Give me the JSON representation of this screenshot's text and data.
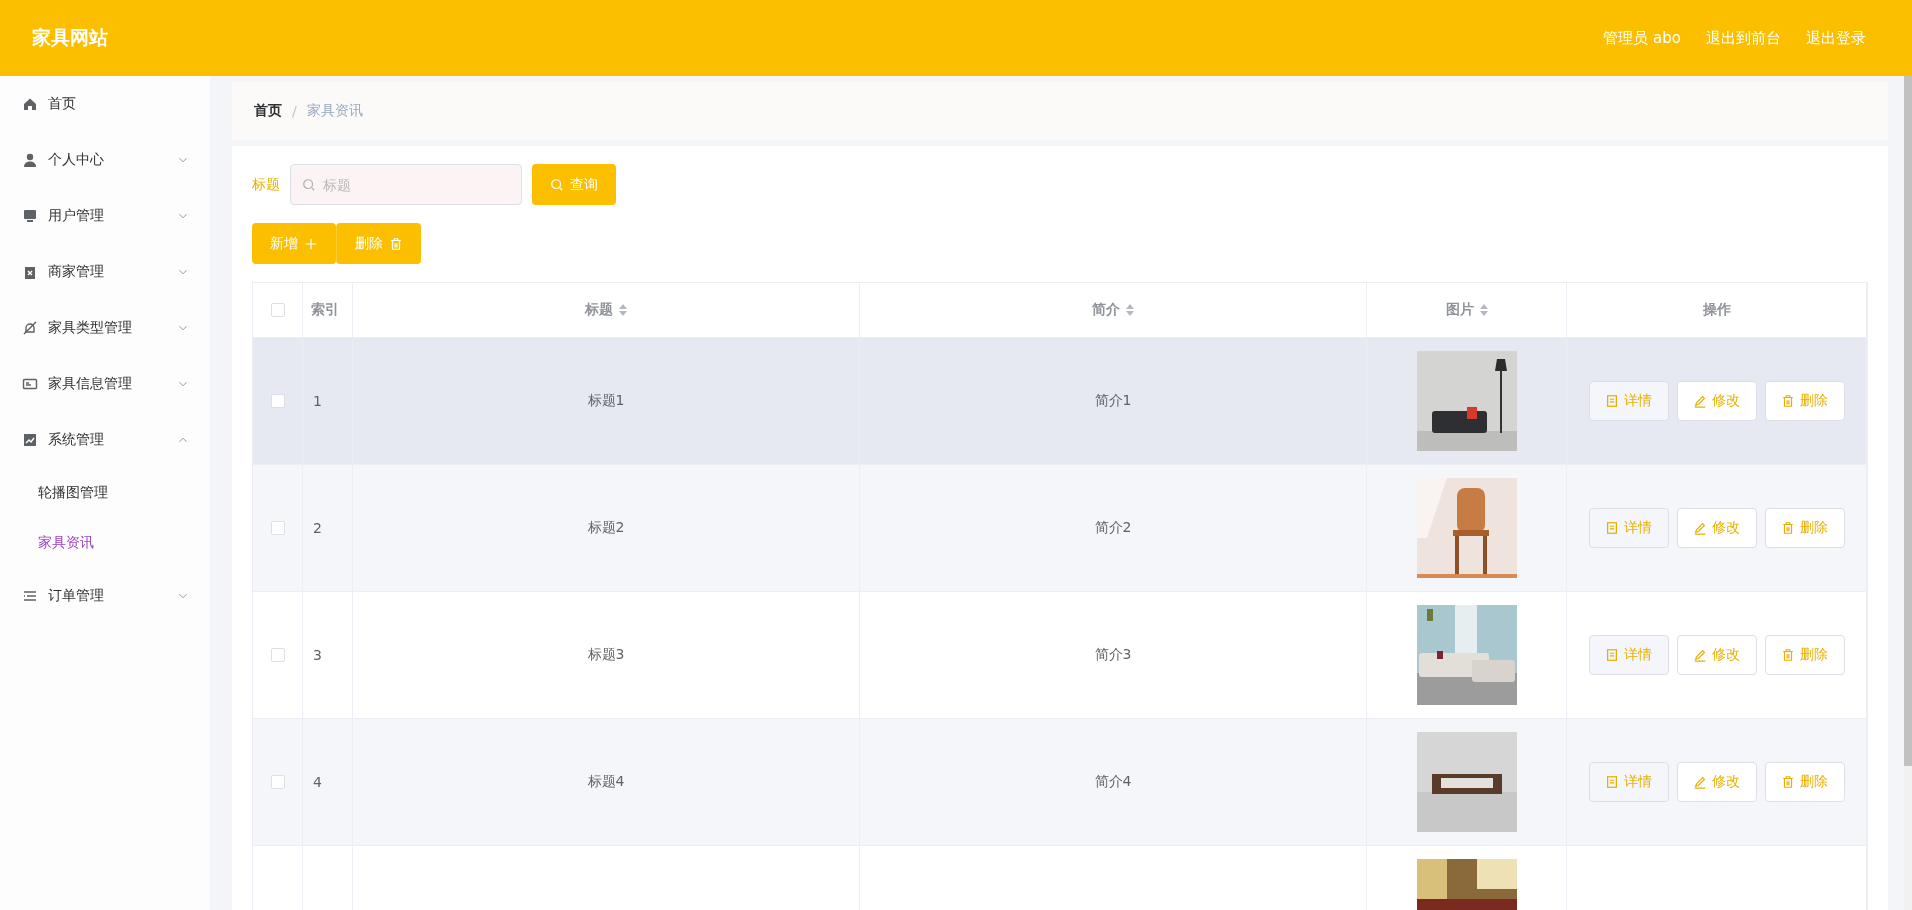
{
  "header": {
    "title": "家具网站",
    "links": [
      "管理员 abo",
      "退出到前台",
      "退出登录"
    ]
  },
  "sidebar": {
    "items": [
      {
        "label": "首页",
        "kind": "link",
        "selected": false
      },
      {
        "label": "个人中心",
        "kind": "submenu",
        "expanded": false
      },
      {
        "label": "用户管理",
        "kind": "submenu",
        "expanded": false
      },
      {
        "label": "商家管理",
        "kind": "submenu",
        "expanded": false
      },
      {
        "label": "家具类型管理",
        "kind": "submenu",
        "expanded": false
      },
      {
        "label": "家具信息管理",
        "kind": "submenu",
        "expanded": false
      },
      {
        "label": "系统管理",
        "kind": "submenu",
        "expanded": true,
        "children": [
          {
            "label": "轮播图管理",
            "selected": false
          },
          {
            "label": "家具资讯",
            "selected": true
          }
        ]
      },
      {
        "label": "订单管理",
        "kind": "submenu",
        "expanded": false
      }
    ]
  },
  "breadcrumb": {
    "items": [
      "首页",
      "家具资讯"
    ],
    "separator": "/"
  },
  "search": {
    "label": "标题",
    "placeholder": "标题",
    "button": "查询"
  },
  "actions": [
    "新增",
    "删除"
  ],
  "table": {
    "select_all_checked": false,
    "columns": [
      {
        "label": "索引",
        "sortable": false
      },
      {
        "label": "标题",
        "sortable": true
      },
      {
        "label": "简介",
        "sortable": true
      },
      {
        "label": "图片",
        "sortable": true
      },
      {
        "label": "操作",
        "sortable": false
      }
    ],
    "rows": [
      {
        "kind": "full",
        "hovered": true,
        "checked": false,
        "index": "1",
        "title": "标题1",
        "intro": "简介1",
        "buttons": [
          "详情",
          "修改",
          "删除"
        ]
      },
      {
        "kind": "full",
        "hovered": false,
        "checked": false,
        "index": "2",
        "title": "标题2",
        "intro": "简介2",
        "buttons": [
          "详情",
          "修改",
          "删除"
        ]
      },
      {
        "kind": "full",
        "hovered": false,
        "checked": false,
        "index": "3",
        "title": "标题3",
        "intro": "简介3",
        "buttons": [
          "详情",
          "修改",
          "删除"
        ]
      },
      {
        "kind": "full",
        "hovered": false,
        "checked": false,
        "index": "4",
        "title": "标题4",
        "intro": "简介4",
        "buttons": [
          "详情",
          "修改",
          "删除"
        ]
      },
      {
        "kind": "partial",
        "hovered": false
      }
    ]
  }
}
